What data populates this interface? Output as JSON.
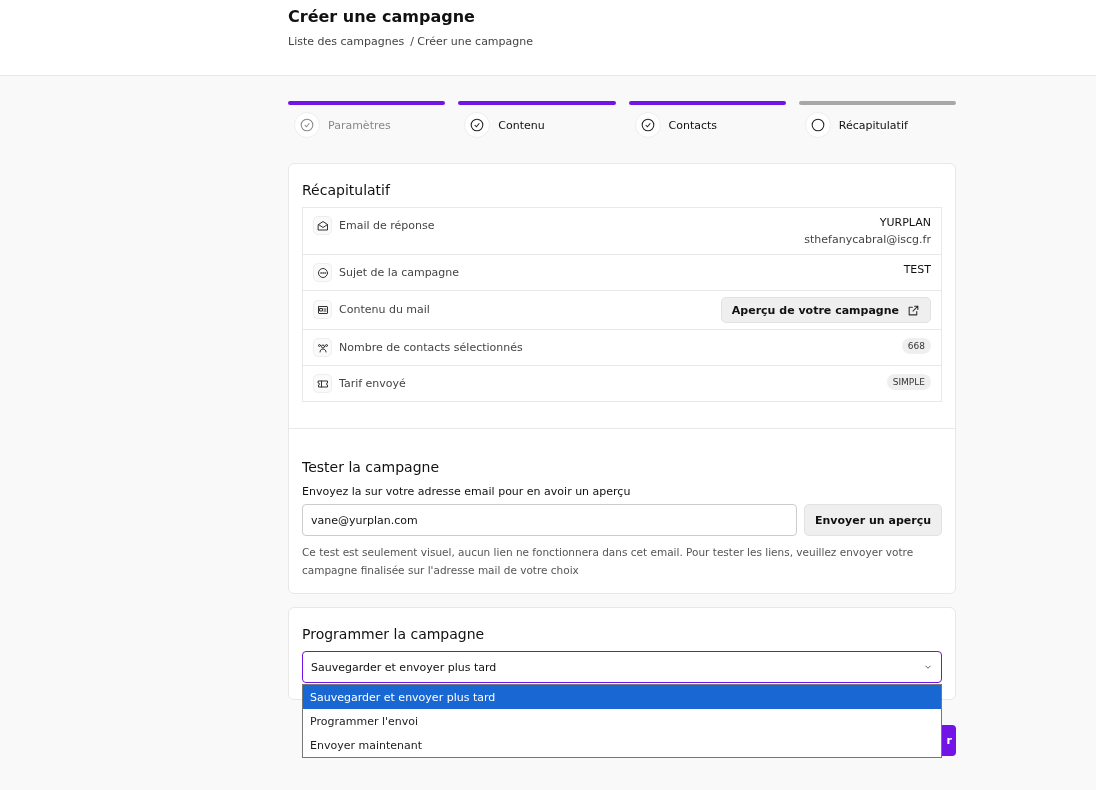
{
  "header": {
    "title": "Créer une campagne",
    "breadcrumb": [
      "Liste des campagnes",
      "/ Créer une campagne"
    ]
  },
  "steps": [
    {
      "label": "Paramètres",
      "completed": true,
      "disabled": true
    },
    {
      "label": "Contenu",
      "completed": true,
      "disabled": false
    },
    {
      "label": "Contacts",
      "completed": true,
      "disabled": false
    },
    {
      "label": "Récapitulatif",
      "completed": false,
      "disabled": false
    }
  ],
  "summary": {
    "title": "Récapitulatif",
    "rows": [
      {
        "label": "Email de réponse",
        "kind": "text",
        "values": [
          "YURPLAN",
          "sthefanycabral@iscg.fr"
        ]
      },
      {
        "label": "Sujet de la campagne",
        "kind": "text",
        "values": [
          "TEST"
        ]
      },
      {
        "label": "Contenu du mail",
        "kind": "button",
        "values": [
          "Aperçu de votre campagne"
        ]
      },
      {
        "label": "Nombre de contacts sélectionnés",
        "kind": "badge",
        "values": [
          "668"
        ]
      },
      {
        "label": "Tarif envoyé",
        "kind": "badge",
        "values": [
          "SIMPLE"
        ]
      }
    ]
  },
  "test": {
    "title": "Tester la campagne",
    "label": "Envoyez la sur votre adresse email pour en avoir un aperçu",
    "value": "vane@yurplan.com",
    "button": "Envoyer un aperçu",
    "help": "Ce test est seulement visuel, aucun lien ne fonctionnera dans cet email. Pour tester les liens, veuillez envoyer votre campagne finalisée sur l'adresse mail de votre choix"
  },
  "schedule": {
    "title": "Programmer la campagne",
    "value": "Sauvegarder et envoyer plus tard",
    "expanded": true,
    "options": [
      {
        "label": "Sauvegarder et envoyer plus tard",
        "selected": true
      },
      {
        "label": "Programmer l'envoi",
        "selected": false
      },
      {
        "label": "Envoyer maintenant",
        "selected": false
      }
    ]
  },
  "footer_button": "r"
}
